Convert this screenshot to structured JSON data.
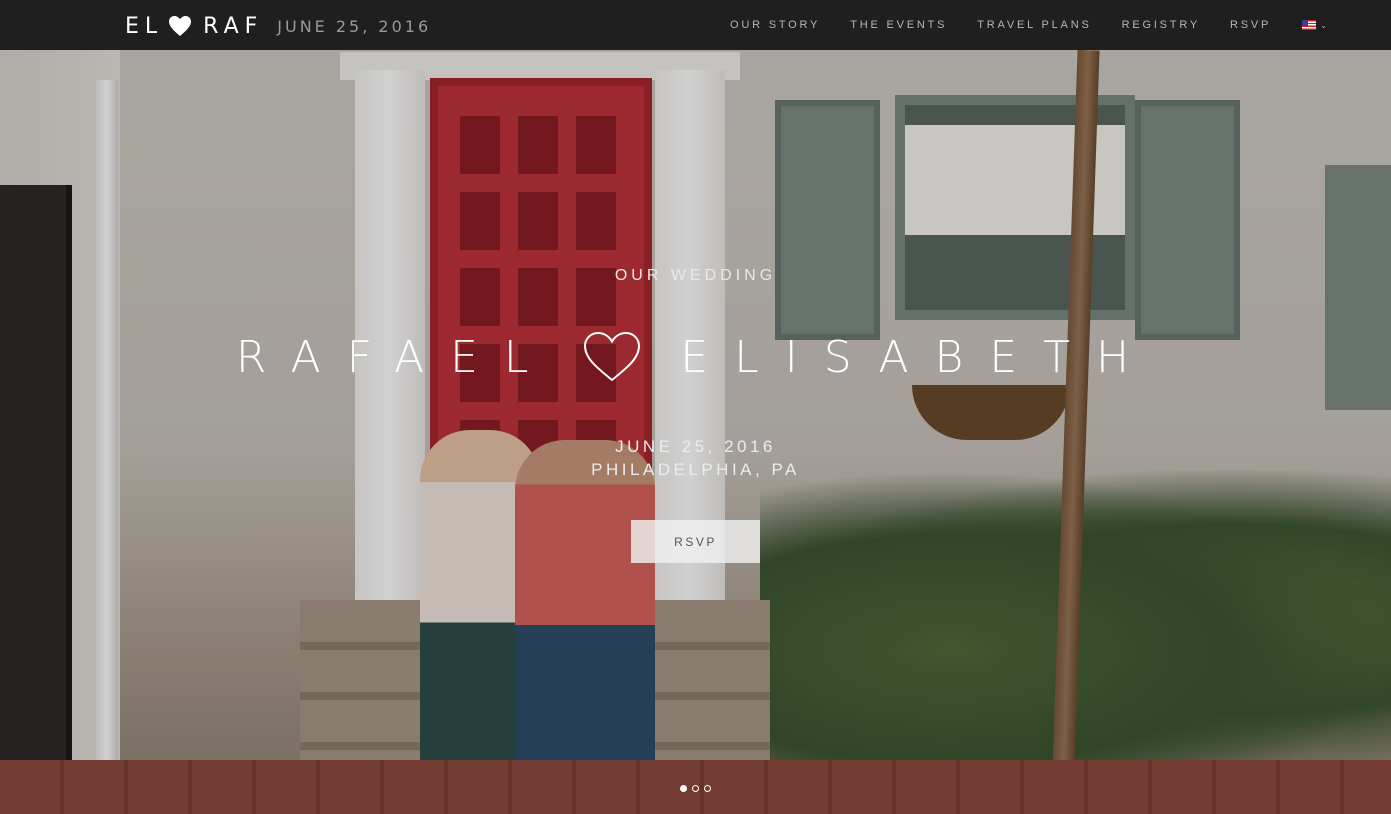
{
  "brand": {
    "left_name": "EL",
    "right_name": "RAF",
    "date": "JUNE 25, 2016",
    "heart_icon": "heart-icon"
  },
  "nav": {
    "items": [
      {
        "label": "OUR STORY"
      },
      {
        "label": "THE EVENTS"
      },
      {
        "label": "TRAVEL PLANS"
      },
      {
        "label": "REGISTRY"
      },
      {
        "label": "RSVP"
      }
    ],
    "language_icon": "us-flag-icon",
    "language_chevron": "chevron-down-icon"
  },
  "hero": {
    "kicker": "OUR WEDDING",
    "groom": "RAFAEL",
    "bride": "ELISABETH",
    "heart_icon": "heart-outline-icon",
    "date": "JUNE 25, 2016",
    "location": "PHILADELPHIA, PA",
    "rsvp_label": "RSVP",
    "slides": {
      "count": 3,
      "active": 1
    }
  },
  "colors": {
    "navbar": "#141414",
    "nav_text": "#b6b6b6",
    "brand_date": "#9a9a9a",
    "button_bg": "#f0f0f0"
  }
}
